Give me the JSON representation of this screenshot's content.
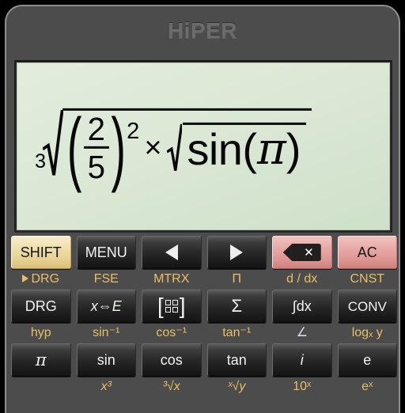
{
  "app": {
    "brand": "HiPER",
    "theme": {
      "panel": "#4c4c4c",
      "display_top": "#e2ecdd",
      "display_bottom": "#cfe0c9",
      "shift_accent": "#f0e0ad",
      "clear_accent": "#e8aba7",
      "second_label": "#e8bf64",
      "key_text": "#f2f2f2"
    }
  },
  "display": {
    "expression_text": "3√((2/5)² × √(sin(π)))",
    "root_index": "3",
    "fraction": {
      "numerator": "2",
      "denominator": "5"
    },
    "exponent": "2",
    "operator": "×",
    "inner_function": "sin",
    "inner_argument": "π",
    "paren_open": "(",
    "paren_close": ")"
  },
  "keypad": {
    "rows": [
      {
        "keys": [
          {
            "label": "SHIFT",
            "name": "shift-key",
            "style": "shift",
            "icon": ""
          },
          {
            "label": "MENU",
            "name": "menu-key",
            "style": "dark",
            "icon": ""
          },
          {
            "label": "",
            "name": "cursor-left-key",
            "style": "dark",
            "icon": "triangle-left-icon"
          },
          {
            "label": "",
            "name": "cursor-right-key",
            "style": "dark",
            "icon": "triangle-right-icon"
          },
          {
            "label": "",
            "name": "backspace-key",
            "style": "red",
            "icon": "backspace-icon"
          },
          {
            "label": "AC",
            "name": "all-clear-key",
            "style": "red",
            "icon": ""
          }
        ],
        "second_labels": [
          {
            "text": "DRG",
            "name": "second-label-drg",
            "marker": true,
            "pale": false
          },
          {
            "text": "FSE",
            "name": "second-label-fse",
            "marker": false,
            "pale": false
          },
          {
            "text": "MTRX",
            "name": "second-label-mtrx",
            "marker": false,
            "pale": false
          },
          {
            "text": "Π",
            "name": "second-label-product",
            "marker": false,
            "pale": false
          },
          {
            "text": "d / dx",
            "name": "second-label-derivative",
            "marker": false,
            "pale": false
          },
          {
            "text": "CNST",
            "name": "second-label-cnst",
            "marker": false,
            "pale": false
          }
        ]
      },
      {
        "keys": [
          {
            "label": "DRG",
            "name": "drg-key",
            "style": "dark",
            "icon": ""
          },
          {
            "label": "x⇔E",
            "name": "x-to-exponent-key",
            "style": "dark",
            "icon": ""
          },
          {
            "label": "",
            "name": "matrix-key",
            "style": "dark",
            "icon": "matrix-icon"
          },
          {
            "label": "Σ",
            "name": "summation-key",
            "style": "dark",
            "icon": ""
          },
          {
            "label": "∫dx",
            "name": "integral-key",
            "style": "dark",
            "icon": ""
          },
          {
            "label": "CONV",
            "name": "convert-key",
            "style": "dark",
            "icon": ""
          }
        ],
        "second_labels": [
          {
            "text": "hyp",
            "name": "second-label-hyp",
            "marker": false,
            "pale": false
          },
          {
            "text": "sin⁻¹",
            "name": "second-label-arcsin",
            "marker": false,
            "pale": false
          },
          {
            "text": "cos⁻¹",
            "name": "second-label-arccos",
            "marker": false,
            "pale": false
          },
          {
            "text": "tan⁻¹",
            "name": "second-label-arctan",
            "marker": false,
            "pale": false
          },
          {
            "text": "∠",
            "name": "second-label-angle",
            "marker": false,
            "pale": true
          },
          {
            "text": "logₓ y",
            "name": "second-label-log-base-x",
            "marker": false,
            "pale": false
          }
        ]
      },
      {
        "keys": [
          {
            "label": "π",
            "name": "pi-key",
            "style": "dark",
            "icon": ""
          },
          {
            "label": "sin",
            "name": "sin-key",
            "style": "dark",
            "icon": ""
          },
          {
            "label": "cos",
            "name": "cos-key",
            "style": "dark",
            "icon": ""
          },
          {
            "label": "tan",
            "name": "tan-key",
            "style": "dark",
            "icon": ""
          },
          {
            "label": "i",
            "name": "imaginary-unit-key",
            "style": "dark",
            "icon": ""
          },
          {
            "label": "e",
            "name": "euler-number-key",
            "style": "dark",
            "icon": ""
          }
        ],
        "second_labels": [
          {
            "text": "",
            "name": "second-label-blank",
            "marker": false,
            "pale": false
          },
          {
            "text": "x³",
            "name": "second-label-cube",
            "marker": false,
            "pale": false
          },
          {
            "text": "³√x",
            "name": "second-label-cube-root",
            "marker": false,
            "pale": false
          },
          {
            "text": "ˣ√y",
            "name": "second-label-nth-root",
            "marker": false,
            "pale": false
          },
          {
            "text": "10ˣ",
            "name": "second-label-ten-power-x",
            "marker": false,
            "pale": false
          },
          {
            "text": "eˣ",
            "name": "second-label-exp",
            "marker": false,
            "pale": false
          }
        ]
      }
    ]
  }
}
